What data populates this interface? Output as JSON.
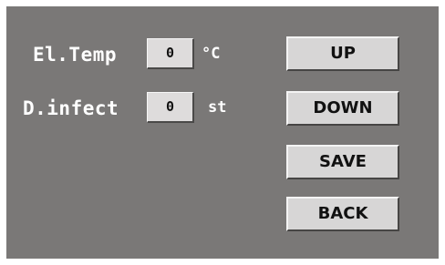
{
  "settings": {
    "el_temp": {
      "label": "El.Temp",
      "value": "0",
      "unit": "°C"
    },
    "d_infect": {
      "label": "D.infect",
      "value": "0",
      "unit": "st"
    }
  },
  "buttons": {
    "up": "UP",
    "down": "DOWN",
    "save": "SAVE",
    "back": "BACK"
  }
}
